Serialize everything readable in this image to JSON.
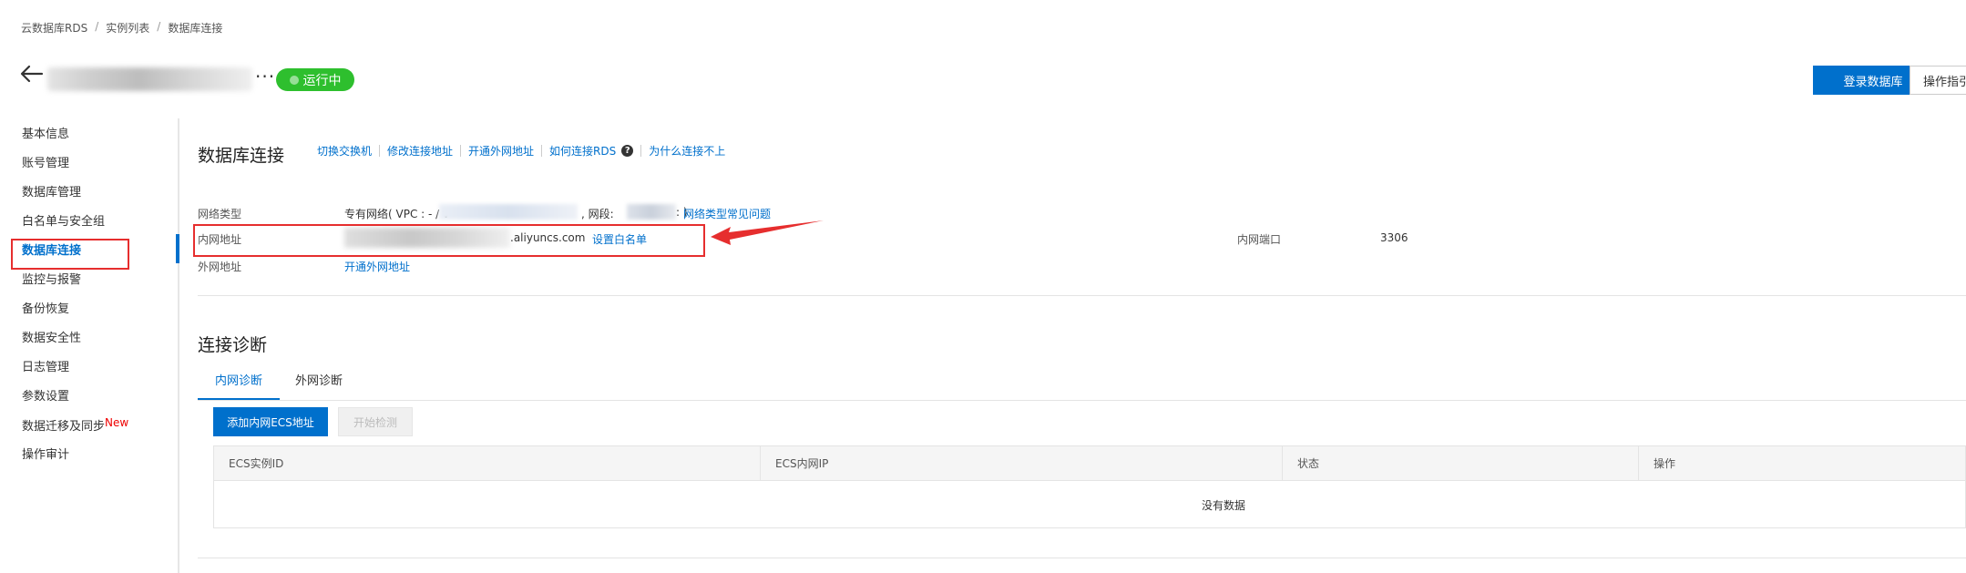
{
  "breadcrumb": {
    "items": [
      "云数据库RDS",
      "实例列表",
      "数据库连接"
    ],
    "separator": "/"
  },
  "header": {
    "status": "运行中",
    "ellipsis": "···",
    "login_button": "登录数据库",
    "guide_button": "操作指引"
  },
  "sidebar": {
    "items": [
      {
        "label": "基本信息"
      },
      {
        "label": "账号管理"
      },
      {
        "label": "数据库管理"
      },
      {
        "label": "白名单与安全组"
      },
      {
        "label": "数据库连接"
      },
      {
        "label": "监控与报警"
      },
      {
        "label": "备份恢复"
      },
      {
        "label": "数据安全性"
      },
      {
        "label": "日志管理"
      },
      {
        "label": "参数设置"
      },
      {
        "label": "数据迁移及同步",
        "badge": "New"
      },
      {
        "label": "操作审计"
      }
    ],
    "active": "数据库连接"
  },
  "connection": {
    "title": "数据库连接",
    "links": [
      "切换交换机",
      "修改连接地址",
      "开通外网地址",
      "如何连接RDS",
      "为什么连接不上"
    ],
    "help_icon": "?",
    "network_type_label": "网络类型",
    "network_type_prefix": "专有网络( VPC : - / v",
    "segment_label": ", 网段:",
    "close_paren": ": )",
    "network_faq_link": "网络类型常见问题",
    "intranet_label": "内网地址",
    "intranet_address_suffix": ".aliyuncs.com",
    "set_whitelist_link": "设置白名单",
    "intranet_port_label": "内网端口",
    "intranet_port_value": "3306",
    "public_label": "外网地址",
    "open_public_link": "开通外网地址"
  },
  "diagnosis": {
    "title": "连接诊断",
    "tabs": [
      "内网诊断",
      "外网诊断"
    ],
    "add_ecs_button": "添加内网ECS地址",
    "start_check_button": "开始检测",
    "table": {
      "columns": [
        "ECS实例ID",
        "ECS内网IP",
        "状态",
        "操作"
      ],
      "empty_text": "没有数据"
    }
  },
  "colors": {
    "accent": "#0070cc",
    "status_green": "#2ebf2e",
    "highlight_red": "#e62e2e"
  }
}
